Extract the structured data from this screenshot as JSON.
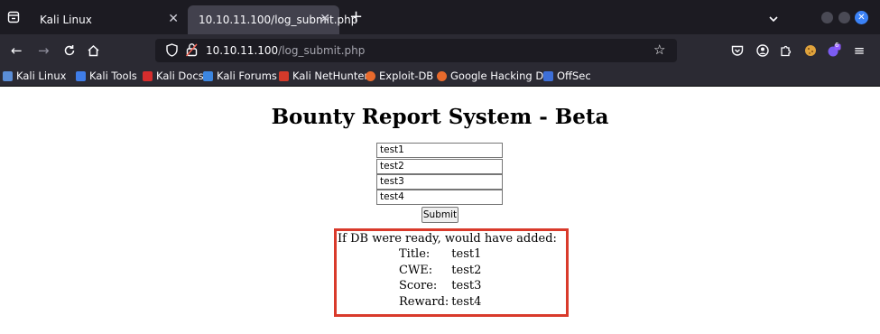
{
  "browser": {
    "tabs": [
      {
        "title": "Kali Linux"
      },
      {
        "title": "10.10.11.100/log_submit.php"
      }
    ],
    "url": {
      "host": "10.10.11.100",
      "path": "/log_submit.php"
    },
    "extension_badge": "6",
    "bookmarks": [
      {
        "label": "Kali Linux",
        "color": "#5a8dd6"
      },
      {
        "label": "Kali Tools",
        "color": "#3f7de8"
      },
      {
        "label": "Kali Docs",
        "color": "#d62d2d"
      },
      {
        "label": "Kali Forums",
        "color": "#3c86e0"
      },
      {
        "label": "Kali NetHunter",
        "color": "#d33a2a"
      },
      {
        "label": "Exploit-DB",
        "color": "#e86a2c"
      },
      {
        "label": "Google Hacking DB",
        "color": "#e86a2c"
      },
      {
        "label": "OffSec",
        "color": "#3d6fd8"
      }
    ]
  },
  "page": {
    "heading": "Bounty Report System - Beta",
    "inputs": [
      "test1",
      "test2",
      "test3",
      "test4"
    ],
    "submit_label": "Submit",
    "result_intro": "If DB were ready, would have added:",
    "result_rows": [
      {
        "label": "Title:",
        "value": "test1"
      },
      {
        "label": "CWE:",
        "value": "test2"
      },
      {
        "label": "Score:",
        "value": "test3"
      },
      {
        "label": "Reward:",
        "value": "test4"
      }
    ],
    "highlight_color": "#d93a2b"
  }
}
